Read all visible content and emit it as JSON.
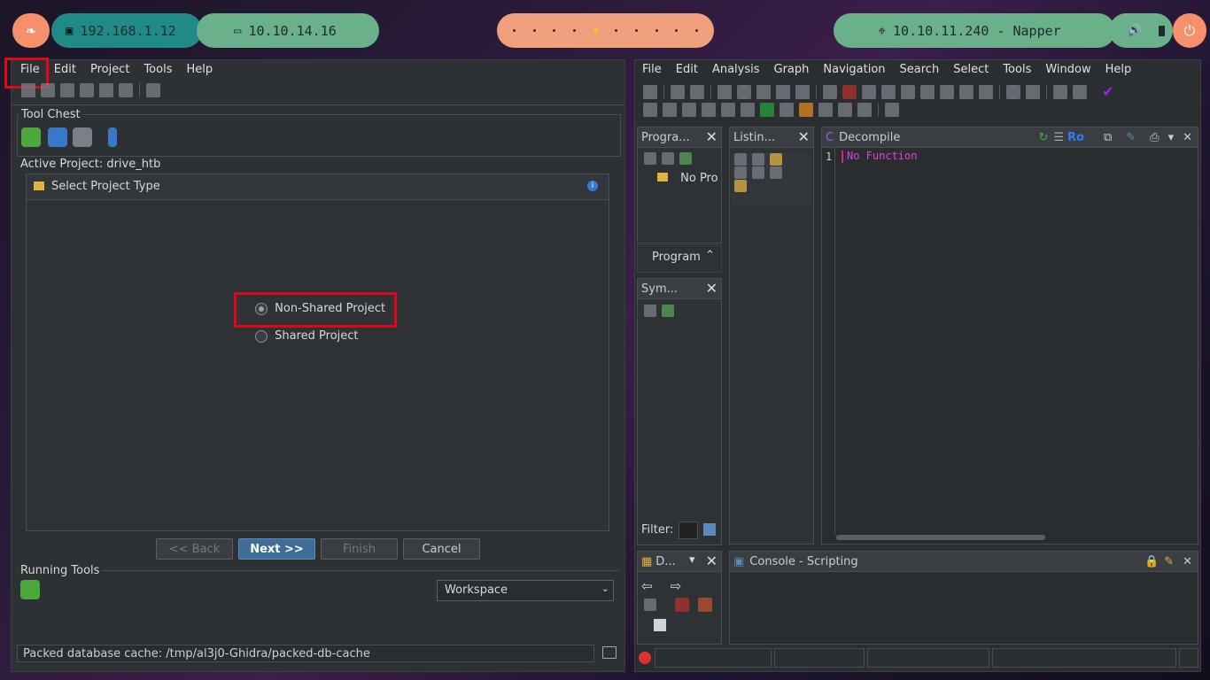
{
  "topbar": {
    "local_ip": "192.168.1.12",
    "vpn_ip": "10.10.14.16",
    "target": "10.10.11.240 - Napper",
    "workspace_dots": 10,
    "active_dot_index": 4,
    "colors": {
      "teal": "#1f8a86",
      "green": "#6ab08b",
      "orange": "#f0a07c",
      "accent_orange": "#f58f6c"
    }
  },
  "project_window": {
    "menu": [
      "File",
      "Edit",
      "Project",
      "Tools",
      "Help"
    ],
    "tool_chest_label": "Tool Chest",
    "active_project": "Active Project: drive_htb",
    "running_tools_label": "Running Tools",
    "workspace_select": "Workspace",
    "status": "Packed database cache: /tmp/al3j0-Ghidra/packed-db-cache"
  },
  "dialog": {
    "title": "Select Project Type",
    "option_nonshared": "Non-Shared Project",
    "option_shared": "Shared Project",
    "selected": "Non-Shared Project",
    "back": "<< Back",
    "next": "Next >>",
    "finish": "Finish",
    "cancel": "Cancel"
  },
  "codebrowser": {
    "menu": [
      "File",
      "Edit",
      "Analysis",
      "Graph",
      "Navigation",
      "Search",
      "Select",
      "Tools",
      "Window",
      "Help"
    ],
    "programs_title": "Progra...",
    "programs_item": "No Pro",
    "program_tab": "Program",
    "symbols_title": "Sym...",
    "filter_label": "Filter:",
    "listing_title": "Listin...",
    "decompile_title": "Decompile",
    "decompile_ro": "Ro",
    "decompile_line_no": "1",
    "decompile_text": "No Function",
    "datatypes_title": "D...",
    "console_title": "Console - Scripting"
  }
}
